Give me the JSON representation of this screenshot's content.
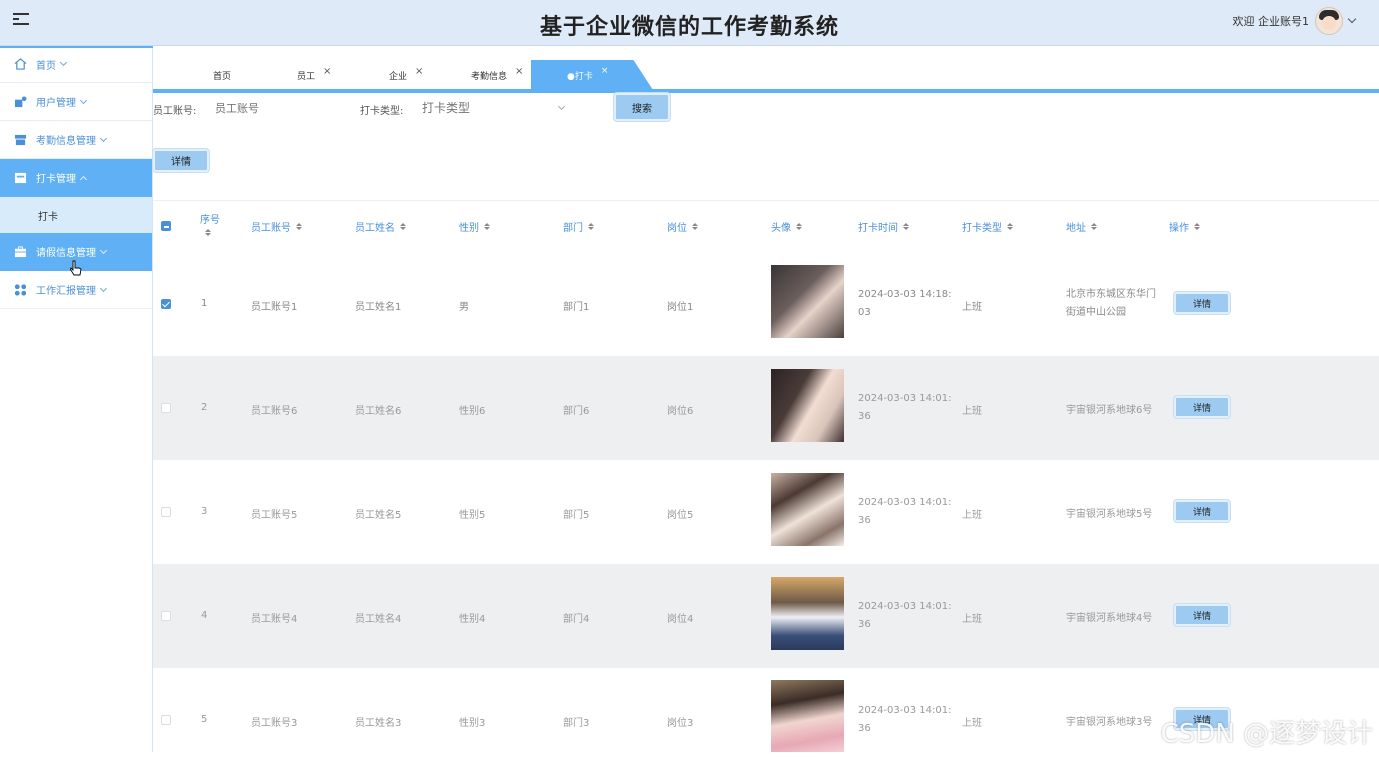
{
  "header": {
    "title": "基于企业微信的工作考勤系统",
    "welcome": "欢迎 企业账号1"
  },
  "sidebar": {
    "items": [
      {
        "label": "首页",
        "icon": "home-icon"
      },
      {
        "label": "用户管理",
        "icon": "users-icon"
      },
      {
        "label": "考勤信息管理",
        "icon": "store-icon"
      },
      {
        "label": "打卡管理",
        "icon": "calendar-icon"
      },
      {
        "label": "请假信息管理",
        "icon": "briefcase-icon"
      },
      {
        "label": "工作汇报管理",
        "icon": "grid-icon"
      }
    ],
    "sub_item": "打卡"
  },
  "tabs": [
    {
      "label": "首页"
    },
    {
      "label": "员工",
      "close": "×"
    },
    {
      "label": "企业",
      "close": "×"
    },
    {
      "label": "考勤信息",
      "close": "×"
    },
    {
      "label": "●打卡",
      "close": "×"
    }
  ],
  "search": {
    "account_label": "员工账号:",
    "account_placeholder": "员工账号",
    "type_label": "打卡类型:",
    "type_placeholder": "打卡类型",
    "search_button": "搜索"
  },
  "toolbar": {
    "detail_button": "详情"
  },
  "table": {
    "columns": [
      "序号",
      "员工账号",
      "员工姓名",
      "性别",
      "部门",
      "岗位",
      "头像",
      "打卡时间",
      "打卡类型",
      "地址",
      "操作"
    ],
    "rows": [
      {
        "index": "1",
        "account": "员工账号1",
        "name": "员工姓名1",
        "gender": "男",
        "dept": "部门1",
        "post": "岗位1",
        "time": "2024-03-03 14:18:03",
        "type": "上班",
        "address": "北京市东城区东华门街道中山公园",
        "action": "详情",
        "checked": true
      },
      {
        "index": "2",
        "account": "员工账号6",
        "name": "员工姓名6",
        "gender": "性别6",
        "dept": "部门6",
        "post": "岗位6",
        "time": "2024-03-03 14:01:36",
        "type": "上班",
        "address": "宇宙银河系地球6号",
        "action": "详情",
        "checked": false
      },
      {
        "index": "3",
        "account": "员工账号5",
        "name": "员工姓名5",
        "gender": "性别5",
        "dept": "部门5",
        "post": "岗位5",
        "time": "2024-03-03 14:01:36",
        "type": "上班",
        "address": "宇宙银河系地球5号",
        "action": "详情",
        "checked": false
      },
      {
        "index": "4",
        "account": "员工账号4",
        "name": "员工姓名4",
        "gender": "性别4",
        "dept": "部门4",
        "post": "岗位4",
        "time": "2024-03-03 14:01:36",
        "type": "上班",
        "address": "宇宙银河系地球4号",
        "action": "详情",
        "checked": false
      },
      {
        "index": "5",
        "account": "员工账号3",
        "name": "员工姓名3",
        "gender": "性别3",
        "dept": "部门3",
        "post": "岗位3",
        "time": "2024-03-03 14:01:36",
        "type": "上班",
        "address": "宇宙银河系地球3号",
        "action": "详情",
        "checked": false
      }
    ]
  },
  "watermark": "CSDN @逐梦设计",
  "colors": {
    "accent": "#5fb0f5",
    "button": "#9ccaf0",
    "link": "#4a90d9"
  }
}
